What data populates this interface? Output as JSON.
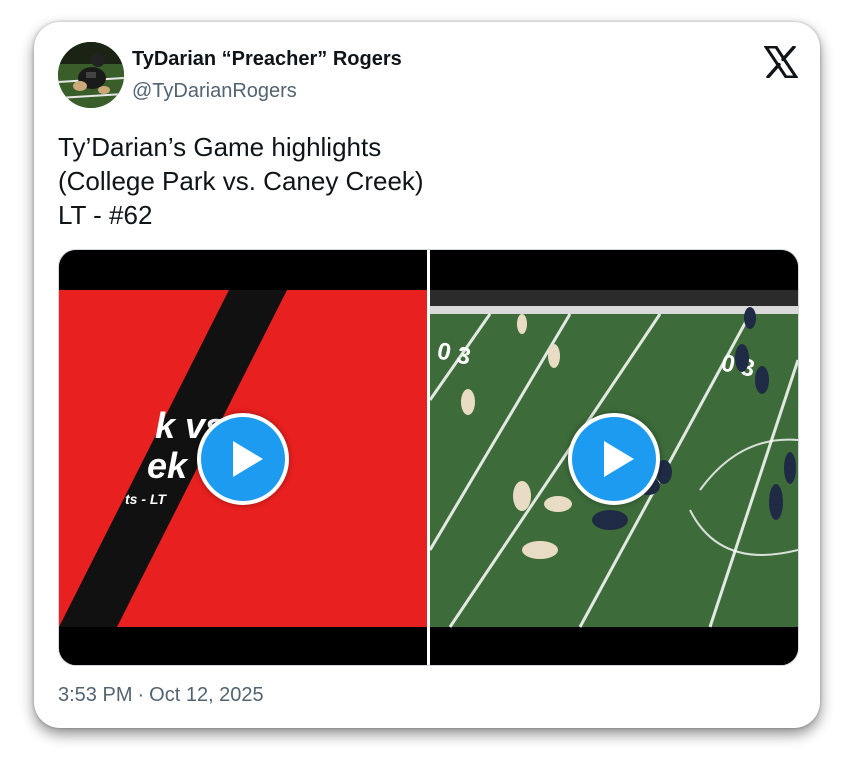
{
  "author": {
    "name": "TyDarian “Preacher” Rogers",
    "handle": "@TyDarianRogers"
  },
  "platform_icon": "x-logo-icon",
  "tweet": {
    "lines": [
      "Ty’Darian’s Game highlights",
      "(College Park vs. Caney Creek)",
      "LT - #62"
    ]
  },
  "media": {
    "videos": [
      {
        "icon": "play-icon",
        "title_fragments": [
          "k vs",
          "ek",
          "ts - LT"
        ],
        "colors": {
          "background": "#e8201f",
          "stripe": "#111111",
          "text": "#ffffff"
        }
      },
      {
        "icon": "play-icon",
        "yard_markers": [
          "0 3",
          "0 3"
        ],
        "colors": {
          "field": "#3d6b3a",
          "lines": "#ffffff"
        }
      }
    ]
  },
  "timestamp": {
    "time": "3:53 PM",
    "separator": "·",
    "date": "Oct 12, 2025"
  },
  "colors": {
    "accent": "#1d9bf0",
    "text_primary": "#0f1419",
    "text_secondary": "#536471"
  }
}
